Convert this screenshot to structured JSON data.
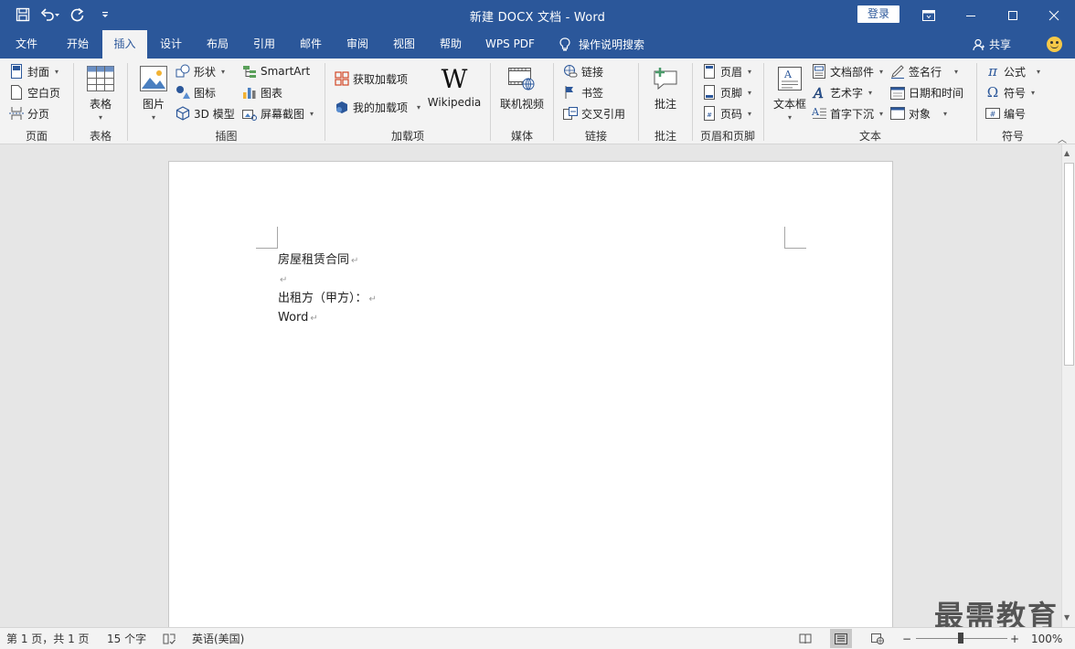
{
  "app": {
    "title": "新建 DOCX 文档  -  Word",
    "login_label": "登录"
  },
  "tabs": [
    {
      "label": "文件"
    },
    {
      "label": "开始"
    },
    {
      "label": "插入"
    },
    {
      "label": "设计"
    },
    {
      "label": "布局"
    },
    {
      "label": "引用"
    },
    {
      "label": "邮件"
    },
    {
      "label": "审阅"
    },
    {
      "label": "视图"
    },
    {
      "label": "帮助"
    },
    {
      "label": "WPS PDF"
    }
  ],
  "active_tab": "插入",
  "help_search": {
    "label": "操作说明搜索"
  },
  "share_label": "共享",
  "ribbon": {
    "pages": {
      "label": "页面",
      "cover": "封面",
      "blank": "空白页",
      "break": "分页"
    },
    "tables": {
      "label": "表格",
      "table": "表格"
    },
    "illustrations": {
      "label": "插图",
      "pictures": "图片",
      "shapes": "形状",
      "icons": "图标",
      "model3d": "3D 模型",
      "smartart": "SmartArt",
      "chart": "图表",
      "screenshot": "屏幕截图"
    },
    "addins": {
      "label": "加载项",
      "get": "获取加载项",
      "mine": "我的加载项",
      "wikipedia": "Wikipedia"
    },
    "media": {
      "label": "媒体",
      "video": "联机视频"
    },
    "links": {
      "label": "链接",
      "link": "链接",
      "bookmark": "书签",
      "crossref": "交叉引用"
    },
    "comments": {
      "label": "批注",
      "comment": "批注"
    },
    "header_footer": {
      "label": "页眉和页脚",
      "header": "页眉",
      "footer": "页脚",
      "page_number": "页码"
    },
    "text": {
      "label": "文本",
      "textbox": "文本框",
      "quick_parts": "文档部件",
      "wordart": "艺术字",
      "drop_cap": "首字下沉",
      "signature": "签名行",
      "datetime": "日期和时间",
      "object": "对象"
    },
    "symbols": {
      "label": "符号",
      "equation": "公式",
      "symbol": "符号",
      "number": "编号"
    }
  },
  "document": {
    "lines": [
      "房屋租赁合同",
      "",
      "出租方（甲方）：",
      "Word"
    ]
  },
  "watermark": "最需教育",
  "status": {
    "page": "第 1 页，共 1 页",
    "words": "15 个字",
    "language": "英语(美国)",
    "zoom": "100%"
  },
  "colors": {
    "accent": "#2b579a",
    "ribbon_bg": "#f3f3f3",
    "canvas_bg": "#e6e6e6"
  }
}
